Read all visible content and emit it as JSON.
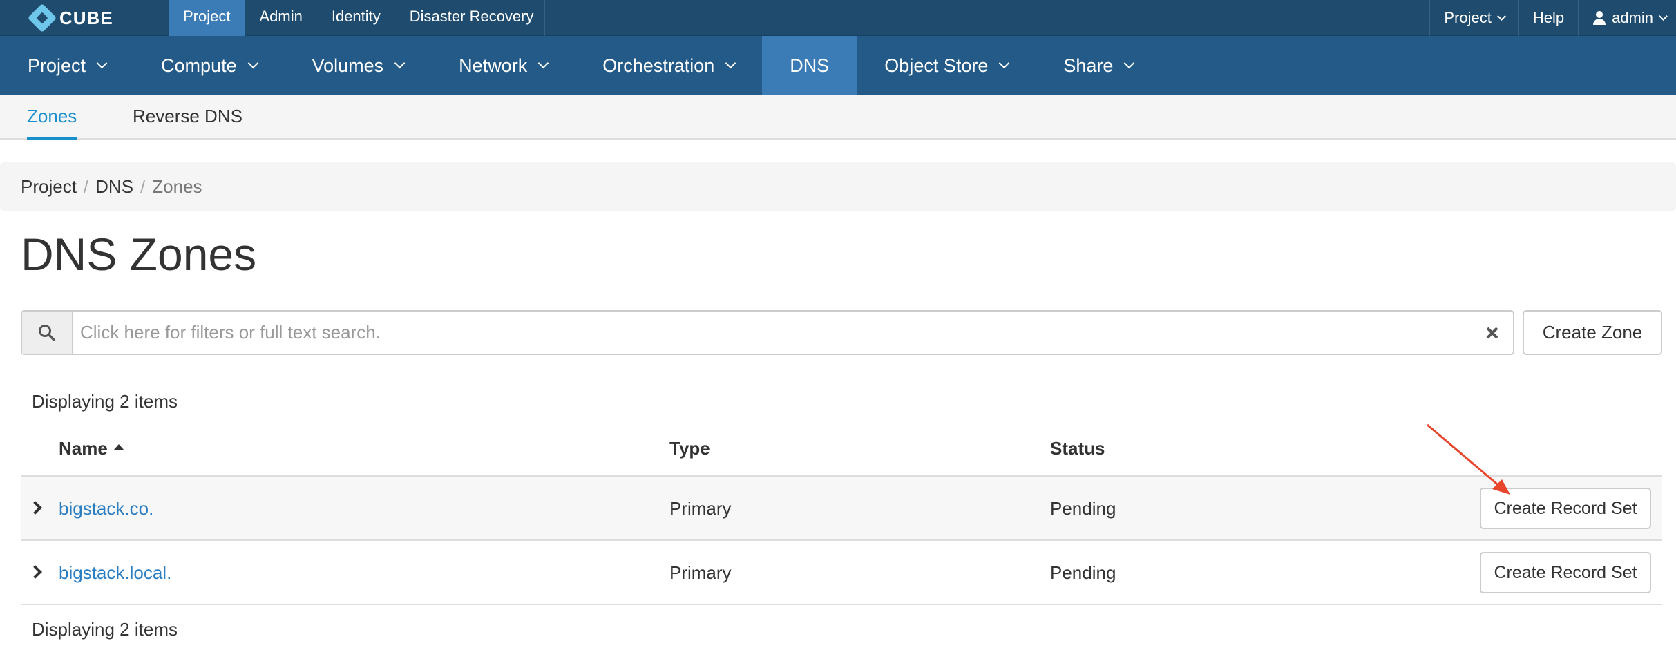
{
  "topbar": {
    "logo_text": "CUBE",
    "left_items": [
      {
        "label": "Project"
      },
      {
        "label": "Admin"
      },
      {
        "label": "Identity"
      },
      {
        "label": "Disaster Recovery"
      }
    ],
    "project_menu": "Project",
    "help": "Help",
    "user": "admin"
  },
  "mainnav": {
    "items": [
      {
        "label": "Project"
      },
      {
        "label": "Compute"
      },
      {
        "label": "Volumes"
      },
      {
        "label": "Network"
      },
      {
        "label": "Orchestration"
      },
      {
        "label": "DNS"
      },
      {
        "label": "Object Store"
      },
      {
        "label": "Share"
      }
    ],
    "active": "DNS"
  },
  "subnav": {
    "items": [
      {
        "label": "Zones"
      },
      {
        "label": "Reverse DNS"
      }
    ],
    "active": "Zones"
  },
  "breadcrumb": {
    "items": [
      "Project",
      "DNS",
      "Zones"
    ],
    "separator": "/"
  },
  "page": {
    "title": "DNS Zones"
  },
  "search": {
    "placeholder": "Click here for filters or full text search.",
    "value": ""
  },
  "create_zone_button": "Create Zone",
  "table": {
    "count_top": "Displaying 2 items",
    "count_bottom": "Displaying 2 items",
    "columns": [
      "Name",
      "Type",
      "Status"
    ],
    "rows": [
      {
        "name": "bigstack.co.",
        "type": "Primary",
        "status": "Pending",
        "action": "Create Record Set"
      },
      {
        "name": "bigstack.local.",
        "type": "Primary",
        "status": "Pending",
        "action": "Create Record Set"
      }
    ]
  },
  "colors": {
    "topbar": "#1f4b6e",
    "mainnav": "#245a87",
    "active_nav": "#3c7cb6",
    "link": "#2a7dc0",
    "annotation_arrow": "#e8452c"
  }
}
